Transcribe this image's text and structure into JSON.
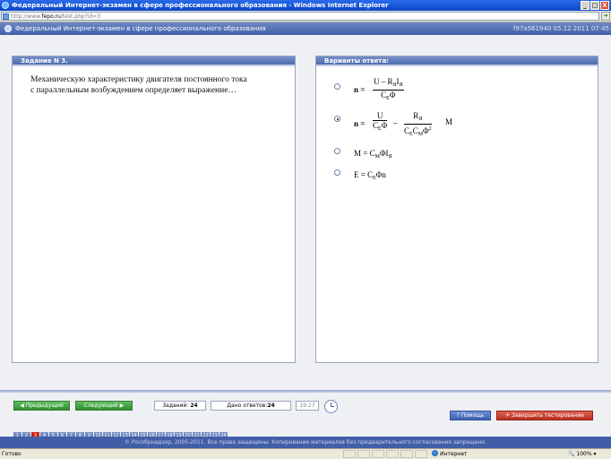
{
  "window": {
    "title": "Федеральный Интернет-экзамен в сфере профессионального образования - Windows Internet Explorer",
    "url_prefix": "http://www.",
    "url_host": "fepo.ru",
    "url_path": "/test.php?id=3",
    "controls": [
      "_",
      "□",
      "X"
    ]
  },
  "header": {
    "title": "Федеральный Интернет-экзамен в сфере профессионального образования",
    "session": "f97a561940 05.12.2011 07:45"
  },
  "task": {
    "heading": "Задание N 3.",
    "question_line1": "Механическую характеристику двигателя постоянного тока",
    "question_line2": "с параллельным возбуждением определяет  выражение…"
  },
  "answers": {
    "heading": "Варианты ответа:",
    "selected_index": 1,
    "options": [
      {
        "lhs": "n =",
        "num_a": "U – R",
        "num_sub": "Я",
        "num_b": "I",
        "num_sub2": "Я",
        "den_a": "C",
        "den_sub": "E",
        "den_b": "Φ"
      },
      {
        "lhs": "n =",
        "f1_num": "U",
        "f1_den_a": "C",
        "f1_den_sub": "E",
        "f1_den_b": "Φ",
        "minus": "–",
        "f2_num_a": "R",
        "f2_num_sub": "Я",
        "f2_den_a": "C",
        "f2_den_sub1": "E",
        "f2_den_b": "C",
        "f2_den_sub2": "M",
        "f2_den_c": "Φ",
        "f2_den_sup": "2",
        "tail": "M"
      },
      {
        "a": "M = C",
        "sub1": "M",
        "b": "ΦI",
        "sub2": "Я"
      },
      {
        "a": "E = C",
        "sub1": "E",
        "b": "Φn"
      }
    ]
  },
  "nav": {
    "prev_label": "Предыдущий",
    "next_label": "Следующий",
    "tasks_label": "Заданий:",
    "tasks_count": "24",
    "answered_label": "Дано ответов:",
    "answered_count": "24",
    "time": "19:27",
    "help_label": "Помощь",
    "finish_label": "Завершить тестирование"
  },
  "pages": [
    "1",
    "2",
    "3",
    "4",
    "5",
    "6",
    "7",
    "8",
    "9",
    "10",
    "11",
    "12",
    "13",
    "14",
    "15",
    "16",
    "17",
    "18",
    "19",
    "20",
    "21",
    "22",
    "23",
    "24"
  ],
  "current_page": "3",
  "footer": "© Рособрнадзор, 2005-2011. Все права защищены. Копирование материалов без предварительного согласования запрещено.",
  "status": {
    "left": "Готово",
    "zone": "Интернет",
    "zoom": "100%"
  }
}
